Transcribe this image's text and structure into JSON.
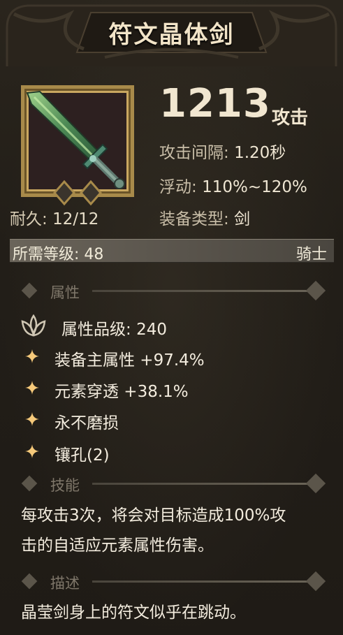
{
  "item": {
    "name": "符文晶体剑",
    "attack_value": "1213",
    "attack_unit": "攻击",
    "durability_label": "耐久:",
    "durability_value": "12/12",
    "stats": [
      {
        "label": "攻击间隔:",
        "value": "1.20秒"
      },
      {
        "label": "浮动:",
        "value": "110%~120%"
      },
      {
        "label": "装备类型:",
        "value": "剑"
      }
    ],
    "required_level_label": "所需等级:",
    "required_level_value": "48",
    "class": "骑士",
    "icon": "sword-icon"
  },
  "sections": {
    "attributes": "属性",
    "skills": "技能",
    "description": "描述"
  },
  "attributes": {
    "grade_label": "属性品级:",
    "grade_value": "240",
    "lines": [
      "装备主属性 +97.4%",
      "元素穿透 +38.1%",
      "永不磨损",
      "镶孔(2)"
    ]
  },
  "skill_text": [
    "每攻击3次，将会对目标造成100%攻",
    "击的自适应元素属性伤害。"
  ],
  "description_text": "晶莹剑身上的符文似乎在跳动。",
  "colors": {
    "gold": "#c9a760",
    "accent": "#f5c97a",
    "text": "#f3ecde"
  }
}
